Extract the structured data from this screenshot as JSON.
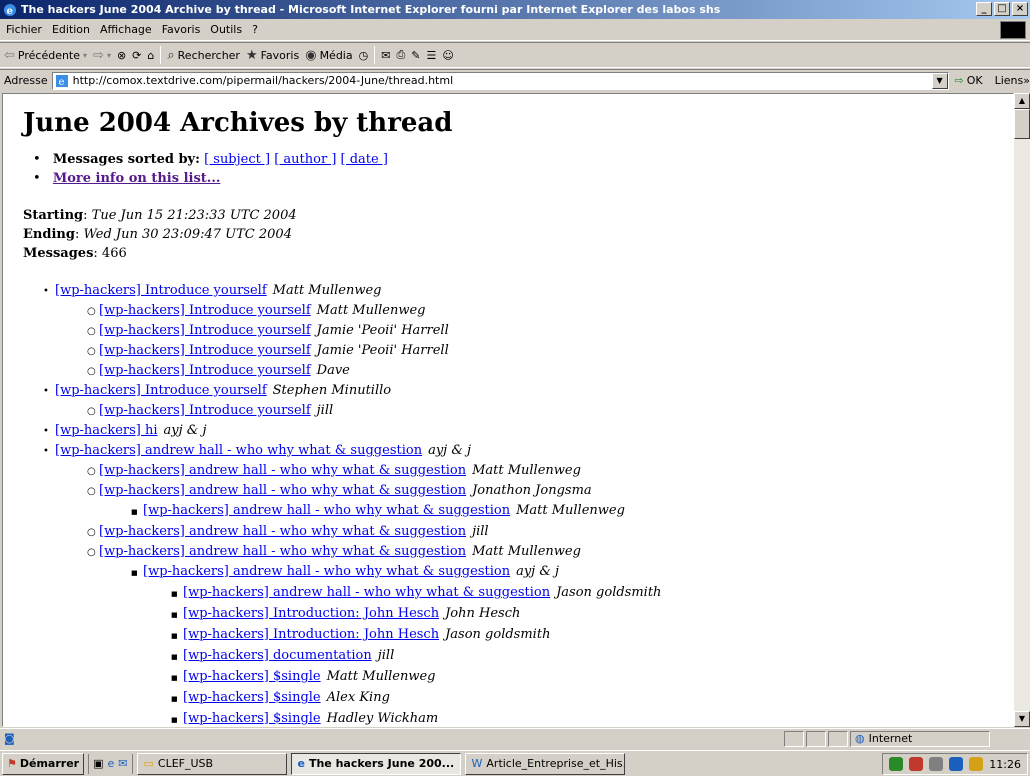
{
  "window": {
    "title": "The hackers June 2004 Archive by thread - Microsoft Internet Explorer fourni par Internet Explorer des labos shs",
    "min": "_",
    "max": "□",
    "close": "×"
  },
  "menu": [
    "Fichier",
    "Edition",
    "Affichage",
    "Favoris",
    "Outils",
    "?"
  ],
  "toolbar": {
    "back": "Précédente",
    "search": "Rechercher",
    "favorites": "Favoris",
    "media": "Média"
  },
  "address": {
    "label": "Adresse",
    "url": "http://comox.textdrive.com/pipermail/hackers/2004-June/thread.html",
    "go": "OK",
    "links": "Liens"
  },
  "page": {
    "title": "June 2004 Archives by thread",
    "sorted_label": "Messages sorted by:",
    "sort_subject": "[ subject ]",
    "sort_author": "[ author ]",
    "sort_date": "[ date ]",
    "more_info": "More info on this list...",
    "starting_label": "Starting",
    "starting_value": "Tue Jun 15 21:23:33 UTC 2004",
    "ending_label": "Ending",
    "ending_value": "Wed Jun 30 23:09:47 UTC 2004",
    "messages_label": "Messages",
    "messages_value": "466",
    "threads": [
      {
        "level": 0,
        "subject": "[wp-hackers] Introduce yourself",
        "author": "Matt Mullenweg"
      },
      {
        "level": 1,
        "subject": "[wp-hackers] Introduce yourself",
        "author": "Matt Mullenweg"
      },
      {
        "level": 1,
        "subject": "[wp-hackers] Introduce yourself",
        "author": "Jamie 'Peoii' Harrell"
      },
      {
        "level": 1,
        "subject": "[wp-hackers] Introduce yourself",
        "author": "Jamie 'Peoii' Harrell"
      },
      {
        "level": 1,
        "subject": "[wp-hackers] Introduce yourself",
        "author": "Dave"
      },
      {
        "level": 0,
        "subject": "[wp-hackers] Introduce yourself",
        "author": "Stephen Minutillo"
      },
      {
        "level": 1,
        "subject": "[wp-hackers] Introduce yourself",
        "author": "jill"
      },
      {
        "level": 0,
        "subject": "[wp-hackers] hi",
        "author": "ayj & j"
      },
      {
        "level": 0,
        "subject": "[wp-hackers] andrew hall - who why what & suggestion",
        "author": "ayj & j"
      },
      {
        "level": 1,
        "subject": "[wp-hackers] andrew hall - who why what & suggestion",
        "author": "Matt Mullenweg"
      },
      {
        "level": 1,
        "subject": "[wp-hackers] andrew hall - who why what & suggestion",
        "author": "Jonathon Jongsma"
      },
      {
        "level": 2,
        "subject": "[wp-hackers] andrew hall - who why what & suggestion",
        "author": "Matt Mullenweg"
      },
      {
        "level": 1,
        "subject": "[wp-hackers] andrew hall - who why what & suggestion",
        "author": "jill"
      },
      {
        "level": 1,
        "subject": "[wp-hackers] andrew hall - who why what & suggestion",
        "author": "Matt Mullenweg"
      },
      {
        "level": 2,
        "subject": "[wp-hackers] andrew hall - who why what & suggestion",
        "author": "ayj & j"
      },
      {
        "level": 3,
        "subject": "[wp-hackers] andrew hall - who why what & suggestion",
        "author": "Jason goldsmith"
      },
      {
        "level": 3,
        "subject": "[wp-hackers] Introduction: John Hesch",
        "author": "John Hesch"
      },
      {
        "level": 3,
        "subject": "[wp-hackers] Introduction: John Hesch",
        "author": "Jason goldsmith"
      },
      {
        "level": 3,
        "subject": "[wp-hackers] documentation",
        "author": "jill"
      },
      {
        "level": 3,
        "subject": "[wp-hackers] $single",
        "author": "Matt Mullenweg"
      },
      {
        "level": 3,
        "subject": "[wp-hackers] $single",
        "author": "Alex King"
      },
      {
        "level": 3,
        "subject": "[wp-hackers] $single",
        "author": "Hadley Wickham"
      }
    ]
  },
  "status": {
    "zone": "Internet"
  },
  "taskbar": {
    "start": "Démarrer",
    "tasks": [
      "CLEF_USB",
      "The hackers June 200...",
      "Article_Entreprise_et_His..."
    ],
    "clock": "11:26"
  }
}
